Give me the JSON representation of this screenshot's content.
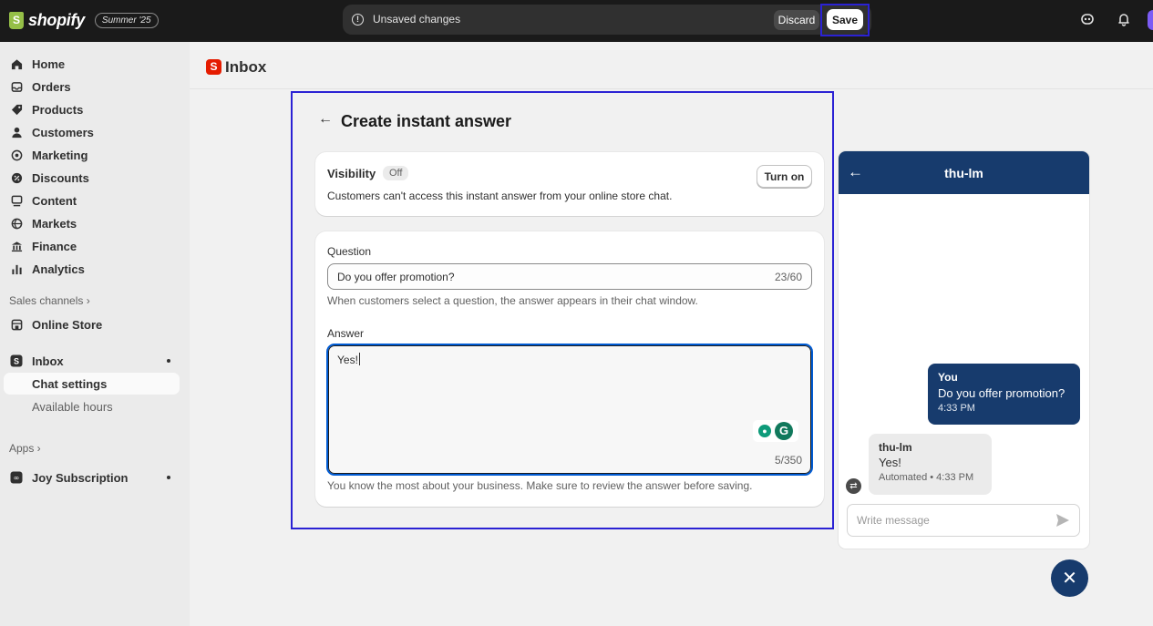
{
  "topbar": {
    "brand": "shopify",
    "edition": "Summer '25",
    "unsaved_text": "Unsaved changes",
    "discard_label": "Discard",
    "save_label": "Save"
  },
  "sidebar": {
    "items": [
      {
        "label": "Home",
        "icon": "home-icon"
      },
      {
        "label": "Orders",
        "icon": "inbox-tray-icon"
      },
      {
        "label": "Products",
        "icon": "tag-icon"
      },
      {
        "label": "Customers",
        "icon": "person-icon"
      },
      {
        "label": "Marketing",
        "icon": "target-icon"
      },
      {
        "label": "Discounts",
        "icon": "discount-icon"
      },
      {
        "label": "Content",
        "icon": "content-icon"
      },
      {
        "label": "Markets",
        "icon": "globe-icon"
      },
      {
        "label": "Finance",
        "icon": "bank-icon"
      },
      {
        "label": "Analytics",
        "icon": "bar-chart-icon"
      }
    ],
    "sales_channels_label": "Sales channels ›",
    "online_store_label": "Online Store",
    "inbox_label": "Inbox",
    "chat_settings_label": "Chat settings",
    "available_hours_label": "Available hours",
    "apps_label": "Apps ›",
    "joy_label": "Joy Subscription"
  },
  "page": {
    "title": "Inbox"
  },
  "form": {
    "title": "Create instant answer",
    "visibility": {
      "title": "Visibility",
      "badge": "Off",
      "description": "Customers can't access this instant answer from your online store chat.",
      "button": "Turn on"
    },
    "question": {
      "label": "Question",
      "value": "Do you offer promotion?",
      "count": "23/60",
      "help": "When customers select a question, the answer appears in their chat window."
    },
    "answer": {
      "label": "Answer",
      "value": "Yes!",
      "count": "5/350",
      "help": "You know the most about your business. Make sure to review the answer before saving."
    }
  },
  "chat": {
    "title": "thu-lm",
    "you_name": "You",
    "you_message": "Do you offer promotion?",
    "you_time": "4:33 PM",
    "bot_name": "thu-lm",
    "bot_message": "Yes!",
    "bot_meta": "Automated • 4:33 PM",
    "input_placeholder": "Write message"
  },
  "colors": {
    "accent": "#2b22d4",
    "chat_brand": "#173b6d",
    "focus_blue": "#005bd3"
  }
}
